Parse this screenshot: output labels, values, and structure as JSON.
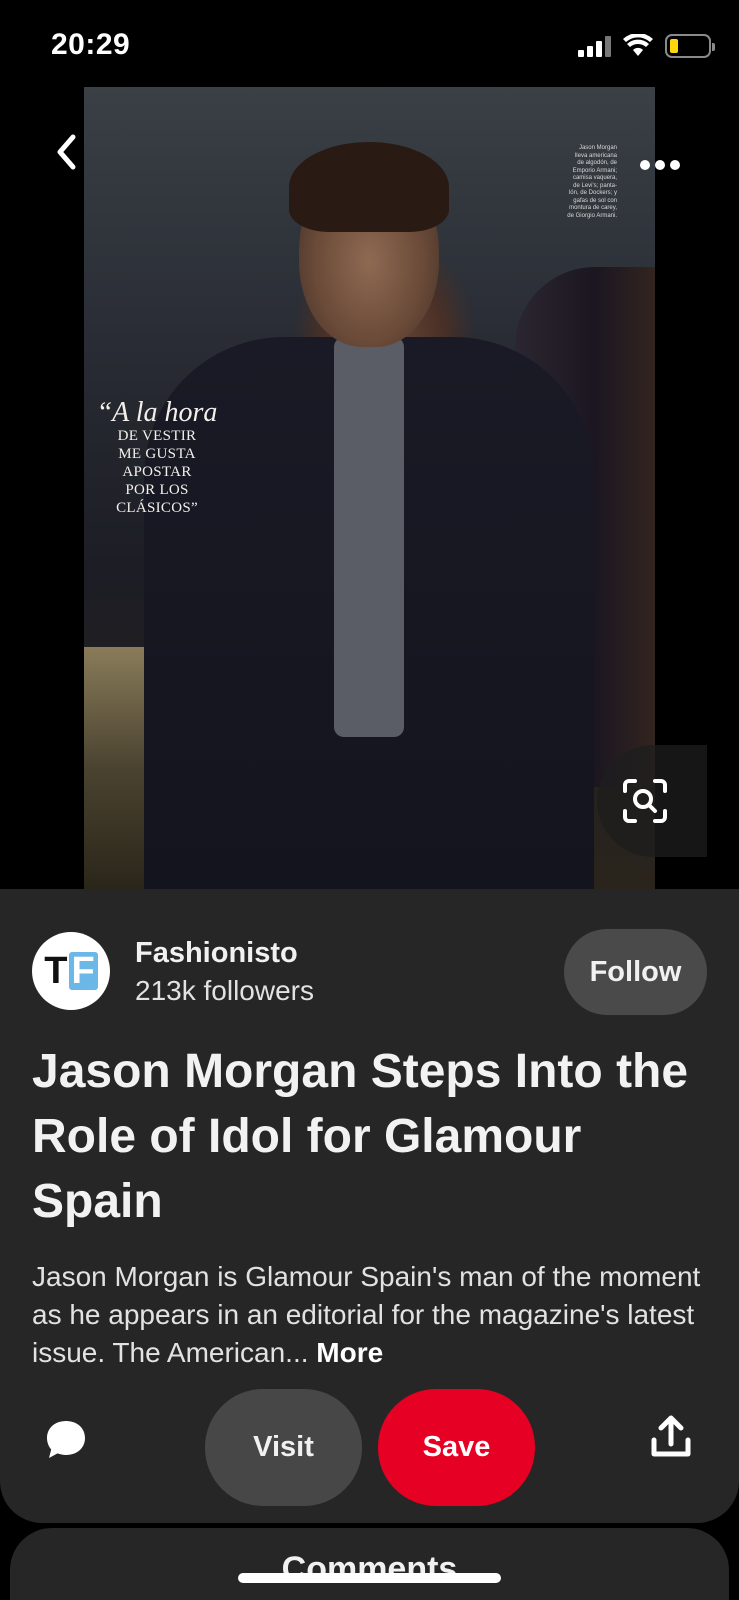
{
  "status_bar": {
    "time": "20:29",
    "icons": [
      "cellular-signal-icon",
      "wifi-icon",
      "battery-low-icon"
    ],
    "battery_color": "#ffd60a"
  },
  "pin_image": {
    "overlay_quote_line1": "“A la hora",
    "overlay_quote_rest": "DE VESTIR\nME GUSTA\nAPOSTAR\nPOR LOS\nCLÁSICOS”",
    "overlay_caption": "Jason Morgan\nlleva americana\nde algodón, de\nEmporio Armani;\ncamisa vaquera,\nde Levi's; panta-\nlón, de Dockers; y\ngafas de sol con\nmontura de carey,\nde Giorgio Armani."
  },
  "nav": {
    "back_icon": "chevron-left-icon",
    "more_icon": "more-dots-icon",
    "visual_search_icon": "visual-search-icon"
  },
  "creator": {
    "avatar_letters": [
      "T",
      "F"
    ],
    "name": "Fashionisto",
    "followers": "213k followers",
    "follow_label": "Follow"
  },
  "pin": {
    "title": "Jason Morgan Steps Into the Role of Idol for Glamour Spain",
    "description": "Jason Morgan is Glamour Spain's man of the moment as he appears in an editorial for the magazine's latest issue. The American...",
    "more_label": "More"
  },
  "actions": {
    "visit_label": "Visit",
    "save_label": "Save",
    "comment_icon": "comment-bubble-icon",
    "share_icon": "share-icon"
  },
  "comments": {
    "title": "Comments"
  },
  "colors": {
    "background": "#000000",
    "sheet": "#262626",
    "save_red": "#e60023",
    "secondary_button": "#474747",
    "avatar_blue": "#6ab7e8"
  }
}
